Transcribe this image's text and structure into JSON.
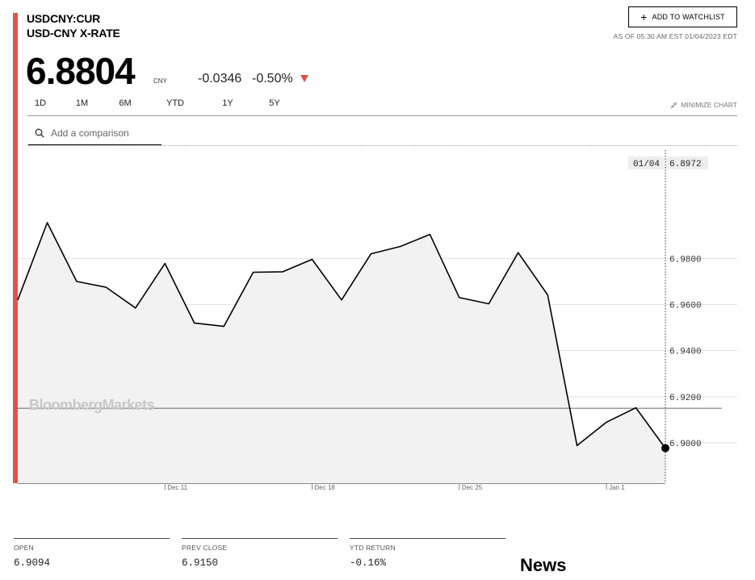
{
  "header": {
    "ticker": "USDCNY:CUR",
    "name": "USD-CNY X-RATE",
    "watchlist_label": "ADD TO WATCHLIST",
    "as_of": "AS OF 05:30 AM EST 01/04/2023 EDT"
  },
  "quote": {
    "price": "6.8804",
    "currency": "CNY",
    "change": "-0.0346",
    "change_pct": "-0.50%",
    "direction_color": "#d9534f"
  },
  "tabs": [
    {
      "label": "1D",
      "active": false
    },
    {
      "label": "1M",
      "active": true
    },
    {
      "label": "6M",
      "active": false
    },
    {
      "label": "YTD",
      "active": false
    },
    {
      "label": "1Y",
      "active": false
    },
    {
      "label": "5Y",
      "active": false
    }
  ],
  "minimize_label": "MINIMIZE CHART",
  "search": {
    "placeholder": "Add a comparison"
  },
  "chart_data": {
    "type": "area",
    "x": [
      "12/05",
      "12/06",
      "12/07",
      "12/08",
      "12/09",
      "12/12",
      "12/13",
      "12/14",
      "12/15",
      "12/16",
      "12/19",
      "12/20",
      "12/21",
      "12/22",
      "12/23",
      "12/26",
      "12/27",
      "12/28",
      "12/29",
      "12/30",
      "01/02",
      "01/03",
      "01/04"
    ],
    "values": [
      6.962,
      6.9955,
      6.97,
      6.9675,
      6.9585,
      6.9778,
      6.952,
      6.9505,
      6.974,
      6.9742,
      6.9796,
      6.962,
      6.982,
      6.9852,
      6.9904,
      6.963,
      6.9603,
      6.9825,
      6.9642,
      6.8988,
      6.909,
      6.9152,
      6.8977
    ],
    "ylim": [
      6.8825,
      7.027
    ],
    "yticks": [
      "6.9000",
      "6.9200",
      "6.9400",
      "6.9600",
      "6.9800"
    ],
    "xtick_labels": [
      {
        "label": "Dec 11",
        "at": 5.0
      },
      {
        "label": "Dec 18",
        "at": 10.0
      },
      {
        "label": "Dec 25",
        "at": 15.0
      },
      {
        "label": "Jan 1",
        "at": 20.0
      }
    ],
    "crosshair": {
      "date": "01/04",
      "value": "6.8972"
    },
    "prev_close": 6.915,
    "watermark": "BloombergMarkets"
  },
  "stats": [
    {
      "label": "OPEN",
      "value": "6.9094"
    },
    {
      "label": "PREV CLOSE",
      "value": "6.9150"
    },
    {
      "label": "YTD RETURN",
      "value": "-0.16%"
    }
  ],
  "news_heading": "News"
}
